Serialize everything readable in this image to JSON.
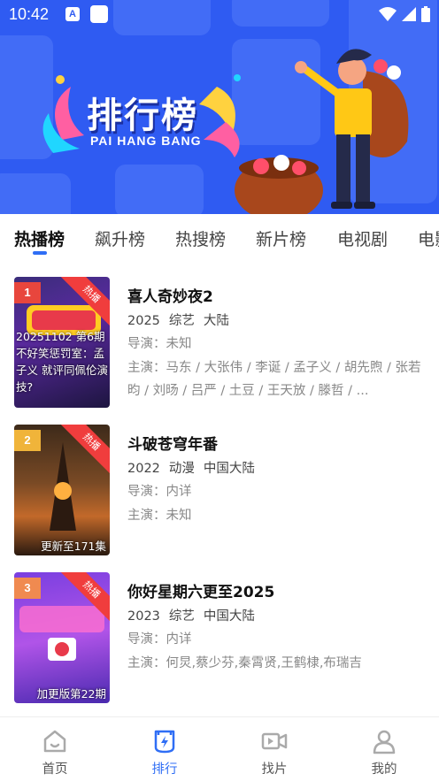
{
  "status_bar": {
    "time": "10:42",
    "a_icon": "A"
  },
  "hero": {
    "title": "排行榜",
    "subtitle": "PAI HANG BANG"
  },
  "tabs": [
    {
      "label": "热播榜",
      "active": true
    },
    {
      "label": "飙升榜"
    },
    {
      "label": "热搜榜"
    },
    {
      "label": "新片榜"
    },
    {
      "label": "电视剧"
    },
    {
      "label": "电影"
    }
  ],
  "items": [
    {
      "rank": "1",
      "badge": "热播",
      "title": "喜人奇妙夜2",
      "year": "2025",
      "genre": "综艺",
      "region": "大陆",
      "director": "导演：未知",
      "cast": "主演：马东 / 大张伟 / 李诞 / 孟子义 / 胡先煦 / 张若昀 / 刘旸 / 吕严 / 土豆 / 王天放 / 滕哲 / ...",
      "poster_overlay": "20251102 第6期 不好笑惩罚室：孟子义 就评同佩伦演技?",
      "poster_caption": ""
    },
    {
      "rank": "2",
      "badge": "热播",
      "title": "斗破苍穹年番",
      "year": "2022",
      "genre": "动漫",
      "region": "中国大陆",
      "director": "导演：内详",
      "cast": "主演：未知",
      "poster_overlay": "",
      "poster_caption": "更新至171集"
    },
    {
      "rank": "3",
      "badge": "热播",
      "title": "你好星期六更至2025",
      "year": "2023",
      "genre": "综艺",
      "region": "中国大陆",
      "director": "导演：内详",
      "cast": "主演：何炅,蔡少芬,秦霄贤,王鹤棣,布瑞吉",
      "poster_overlay": "",
      "poster_caption": "加更版第22期"
    }
  ],
  "bottom_nav": [
    {
      "label": "首页",
      "icon": "home-icon"
    },
    {
      "label": "排行",
      "icon": "ranking-icon",
      "active": true
    },
    {
      "label": "找片",
      "icon": "video-camera-icon"
    },
    {
      "label": "我的",
      "icon": "user-icon"
    }
  ],
  "colors": {
    "hero_bg": "#2f5bf2",
    "accent": "#2f6ef5",
    "hot_badge": "#f03d3d",
    "rank1": "#e8463d",
    "rank2": "#f0b43a",
    "rank3": "#f08a50"
  }
}
